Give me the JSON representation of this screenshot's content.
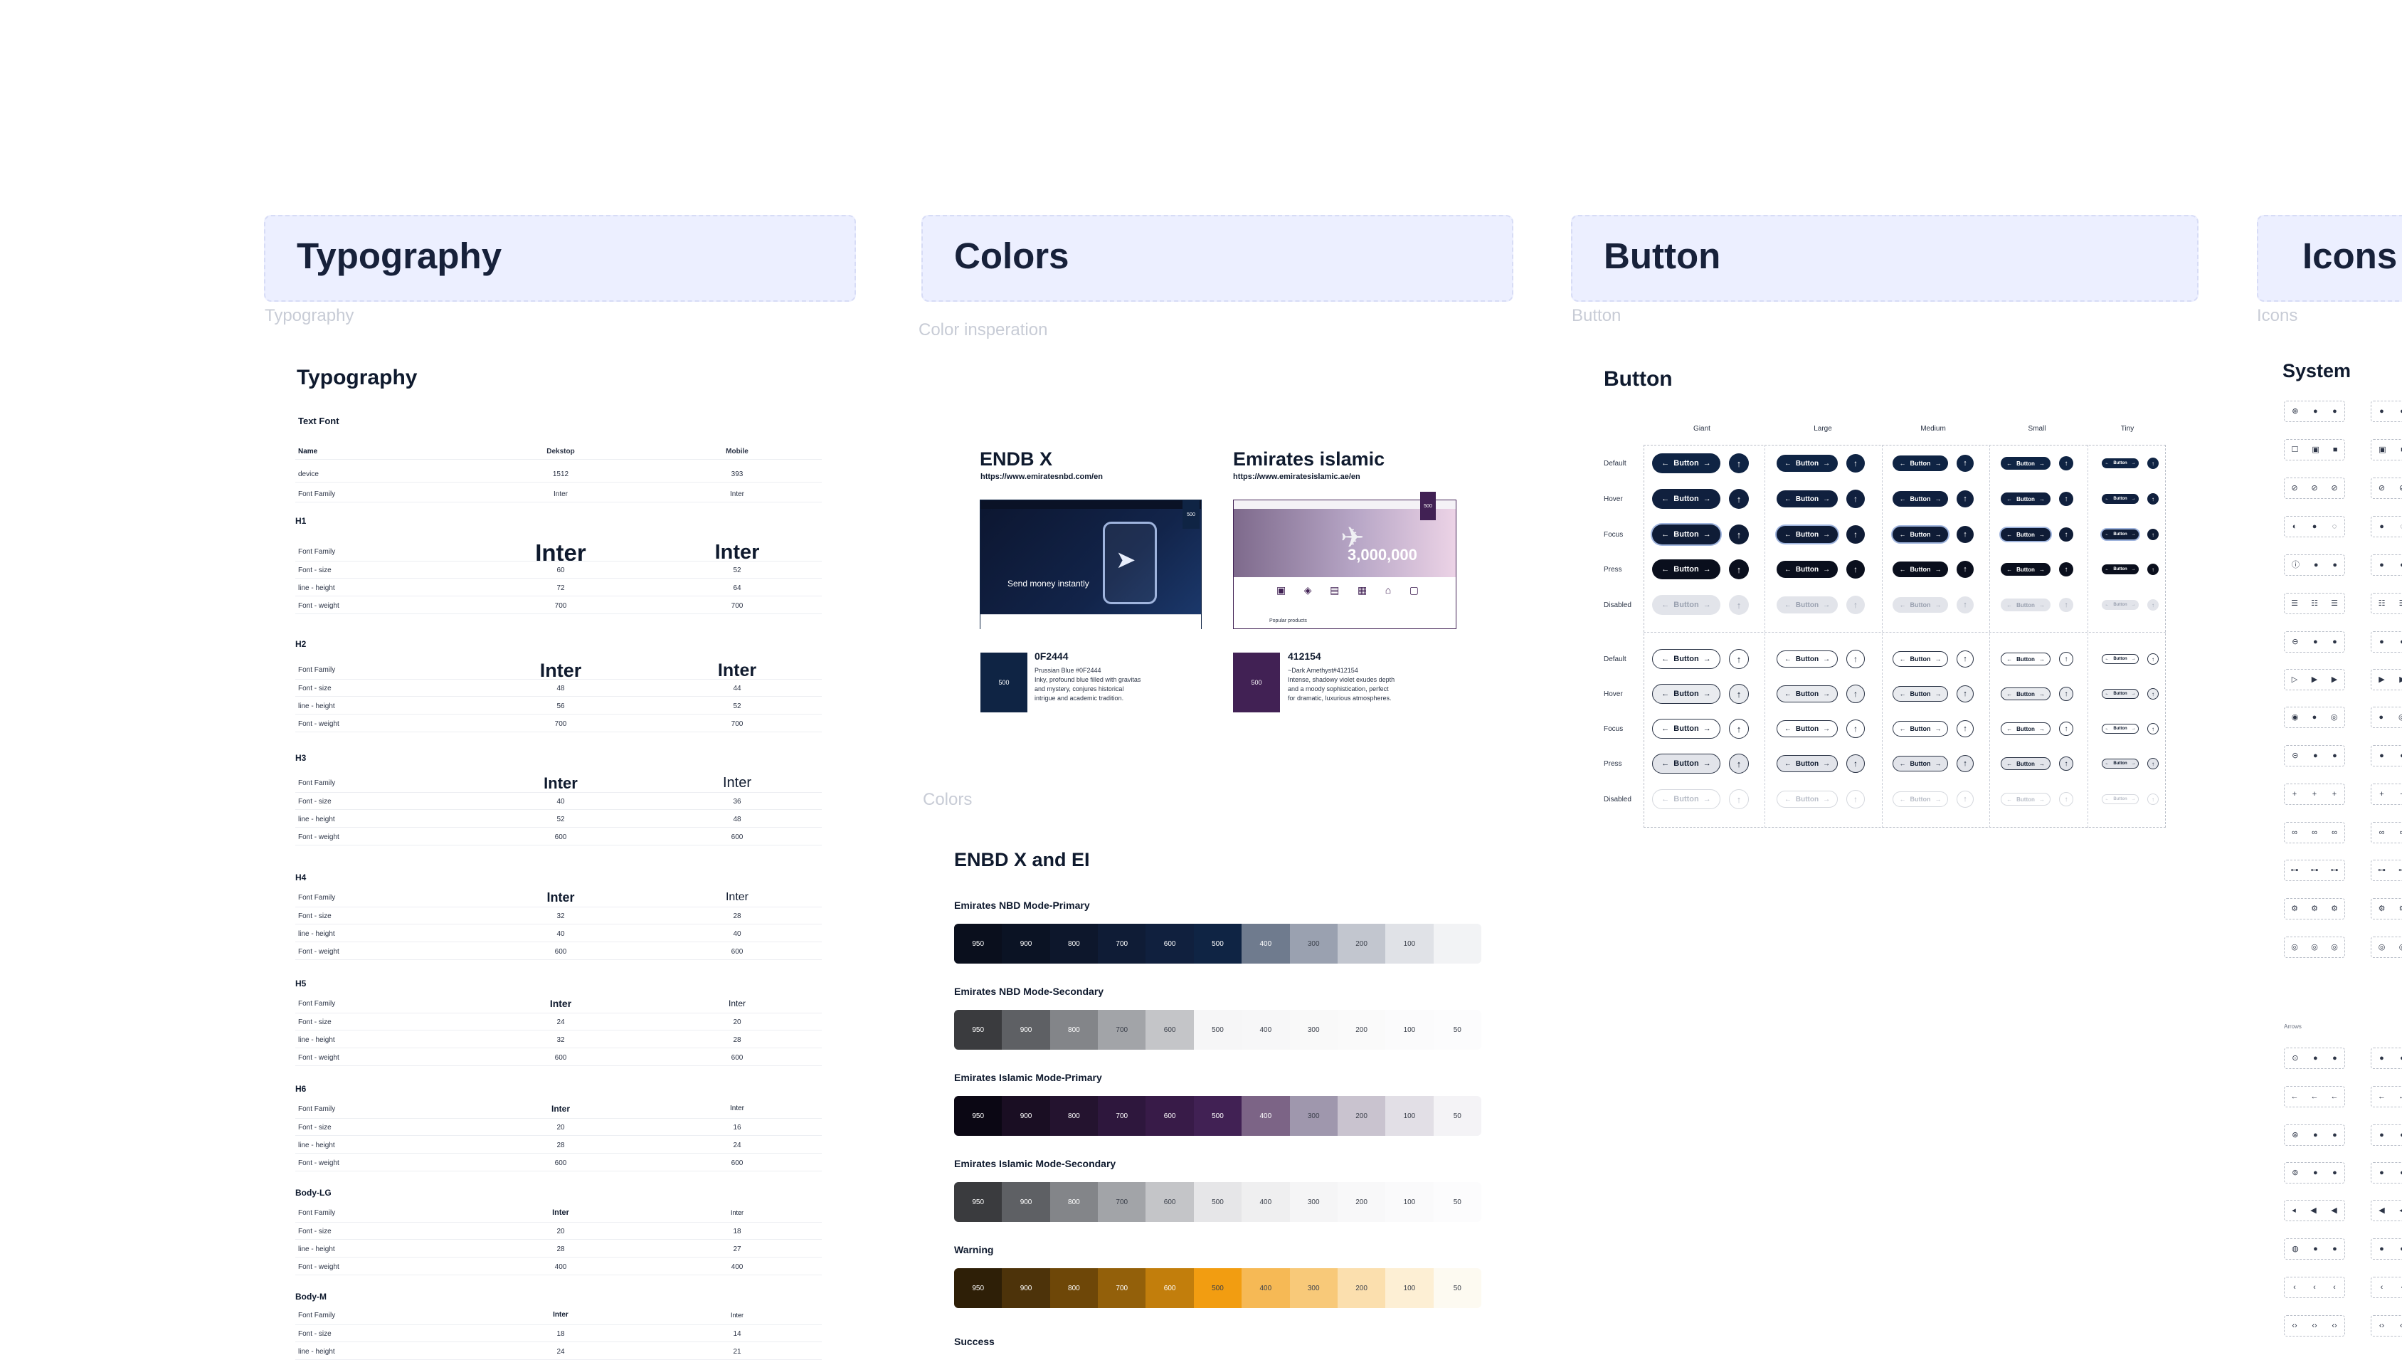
{
  "sections": {
    "typography": {
      "title": "Typography",
      "caption": "Typography"
    },
    "colors": {
      "title": "Colors",
      "caption": "Color insperation",
      "caption2": "Colors"
    },
    "button": {
      "title": "Button",
      "caption": "Button"
    },
    "icons": {
      "title": "Icons",
      "caption": "Icons"
    }
  },
  "typography": {
    "heading": "Typography",
    "subheading": "Text Font",
    "columns": [
      "Name",
      "Dekstop",
      "Mobile"
    ],
    "device_row": {
      "label": "device",
      "desktop": "1512",
      "mobile": "393"
    },
    "family_row": {
      "label": "Font Family",
      "desktop": "Inter",
      "mobile": "Inter"
    },
    "sample_word": "Inter",
    "labels": {
      "family": "Font Family",
      "size": "Font - size",
      "line": "line - height",
      "weight": "Font - weight"
    },
    "styles": [
      {
        "name": "H1",
        "size": [
          "60",
          "52"
        ],
        "line": [
          "72",
          "64"
        ],
        "weight": [
          "700",
          "700"
        ]
      },
      {
        "name": "H2",
        "size": [
          "48",
          "44"
        ],
        "line": [
          "56",
          "52"
        ],
        "weight": [
          "700",
          "700"
        ]
      },
      {
        "name": "H3",
        "size": [
          "40",
          "36"
        ],
        "line": [
          "52",
          "48"
        ],
        "weight": [
          "600",
          "600"
        ]
      },
      {
        "name": "H4",
        "size": [
          "32",
          "28"
        ],
        "line": [
          "40",
          "40"
        ],
        "weight": [
          "600",
          "600"
        ]
      },
      {
        "name": "H5",
        "size": [
          "24",
          "20"
        ],
        "line": [
          "32",
          "28"
        ],
        "weight": [
          "600",
          "600"
        ]
      },
      {
        "name": "H6",
        "size": [
          "20",
          "16"
        ],
        "line": [
          "28",
          "24"
        ],
        "weight": [
          "600",
          "600"
        ]
      },
      {
        "name": "Body-LG",
        "size": [
          "20",
          "18"
        ],
        "line": [
          "28",
          "27"
        ],
        "weight": [
          "400",
          "400"
        ]
      },
      {
        "name": "Body-M",
        "size": [
          "18",
          "14"
        ],
        "line": [
          "24",
          "21"
        ],
        "weight": []
      }
    ]
  },
  "inspiration": {
    "enbd": {
      "name": "ENDB X",
      "url": "https://www.emiratesnbd.com/en",
      "hero_text": "Send money instantly",
      "badge": "500",
      "hex": "0F2444",
      "desc1": "Prussian Blue #0F2444",
      "desc2": "Inky, profound blue filled with gravitas",
      "desc3": "and mystery, conjures historical",
      "desc4": "intrigue and academic tradition.",
      "color": "#0f2444"
    },
    "ei": {
      "name": "Emirates islamic",
      "url": "https://www.emiratesislamic.ae/en",
      "hero_text": "3,000,000",
      "badge": "500",
      "hex": "412154",
      "desc1": "~Dark Amethyst#412154",
      "desc2": "Intense, shadowy violet exudes depth",
      "desc3": "and a moody sophistication, perfect",
      "desc4": "for dramatic, luxurious atmospheres.",
      "color": "#412154",
      "footer": "Popular products"
    }
  },
  "palette": {
    "heading": "ENBD X and EI",
    "ramps": [
      {
        "name": "Emirates NBD Mode-Primary",
        "colors": [
          "#0a0f1d",
          "#0b1324",
          "#0d172c",
          "#0f1c36",
          "#10203e",
          "#0f2444",
          "#6f7b8e",
          "#9aa1b0",
          "#c2c6cf",
          "#e0e2e7",
          "#f2f3f5"
        ],
        "labels": [
          "950",
          "900",
          "800",
          "700",
          "600",
          "500",
          "400",
          "300",
          "200",
          "100",
          ""
        ]
      },
      {
        "name": "Emirates NBD Mode-Secondary",
        "colors": [
          "#3a3b3e",
          "#5e6064",
          "#838589",
          "#a2a4a8",
          "#c4c5c8",
          "#f6f6f7",
          "#f7f7f8",
          "#f9f9f9",
          "#fafafa",
          "#fbfbfc",
          "#fcfcfd"
        ],
        "labels": [
          "950",
          "900",
          "800",
          "700",
          "600",
          "500",
          "400",
          "300",
          "200",
          "100",
          "50"
        ]
      },
      {
        "name": "Emirates Islamic Mode-Primary",
        "colors": [
          "#0b0714",
          "#1a0e23",
          "#24132f",
          "#2e173d",
          "#381b48",
          "#412154",
          "#7c6486",
          "#9f97ad",
          "#c9c3cf",
          "#e2dfe6",
          "#f4f3f6"
        ],
        "labels": [
          "950",
          "900",
          "800",
          "700",
          "600",
          "500",
          "400",
          "300",
          "200",
          "100",
          "50"
        ]
      },
      {
        "name": "Emirates Islamic Mode-Secondary",
        "colors": [
          "#3a3b3e",
          "#5e6064",
          "#838589",
          "#a2a4a8",
          "#c4c5c8",
          "#e6e6e8",
          "#efeff0",
          "#f5f5f6",
          "#f8f8f9",
          "#fafafb",
          "#fcfcfd"
        ],
        "labels": [
          "950",
          "900",
          "800",
          "700",
          "600",
          "500",
          "400",
          "300",
          "200",
          "100",
          "50"
        ]
      },
      {
        "name": "Warning",
        "colors": [
          "#2e1f07",
          "#4d330a",
          "#6e4708",
          "#93600a",
          "#c27e0c",
          "#f29d11",
          "#f6b955",
          "#f8c979",
          "#fbdfae",
          "#fdefd4",
          "#fdfaf1"
        ],
        "labels": [
          "950",
          "900",
          "800",
          "700",
          "600",
          "500",
          "400",
          "300",
          "200",
          "100",
          "50"
        ]
      }
    ],
    "next_label": "Success"
  },
  "button": {
    "heading": "Button",
    "sizes": [
      "Giant",
      "Large",
      "Medium",
      "Small",
      "Tiny"
    ],
    "states": [
      "Default",
      "Hover",
      "Focus",
      "Press",
      "Disabled"
    ],
    "label": "Button"
  },
  "icons": {
    "heading": "System",
    "arrows_label": "Arrows"
  }
}
